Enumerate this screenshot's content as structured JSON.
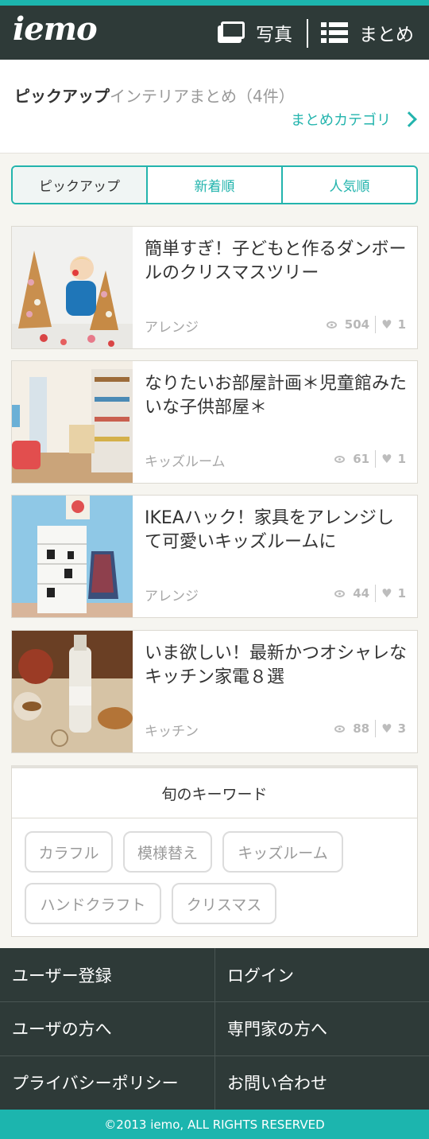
{
  "header": {
    "logo": "iemo",
    "nav_photo": "写真",
    "nav_summary": "まとめ",
    "photo_icon": "photo-stack-icon",
    "list_icon": "list-icon"
  },
  "pickup": {
    "title_strong": "ピックアップ",
    "title_rest": "インテリアまとめ（4件）",
    "category_link": "まとめカテゴリ"
  },
  "tabs": [
    {
      "label": "ピックアップ",
      "active": true
    },
    {
      "label": "新着順",
      "active": false
    },
    {
      "label": "人気順",
      "active": false
    }
  ],
  "articles": [
    {
      "title": "簡単すぎ！子どもと作るダンボールのクリスマスツリー",
      "category": "アレンジ",
      "views": "504",
      "likes": "1"
    },
    {
      "title": "なりたいお部屋計画＊児童館みたいな子供部屋＊",
      "category": "キッズルーム",
      "views": "61",
      "likes": "1"
    },
    {
      "title": "IKEAハック！家具をアレンジして可愛いキッズルームに",
      "category": "アレンジ",
      "views": "44",
      "likes": "1"
    },
    {
      "title": "いま欲しい！最新かつオシャレなキッチン家電８選",
      "category": "キッチン",
      "views": "88",
      "likes": "3"
    }
  ],
  "keywords": {
    "title": "旬のキーワード",
    "items": [
      "カラフル",
      "模様替え",
      "キッズルーム",
      "ハンドクラフト",
      "クリスマス"
    ]
  },
  "footer": {
    "links": [
      "ユーザー登録",
      "ログイン",
      "ユーザの方へ",
      "専門家の方へ",
      "プライバシーポリシー",
      "お問い合わせ"
    ],
    "copyright": "©2013 iemo, ALL RIGHTS RESERVED"
  },
  "colors": {
    "accent": "#1cb5ae",
    "dark": "#2e3a38",
    "background": "#f6f5f0"
  }
}
